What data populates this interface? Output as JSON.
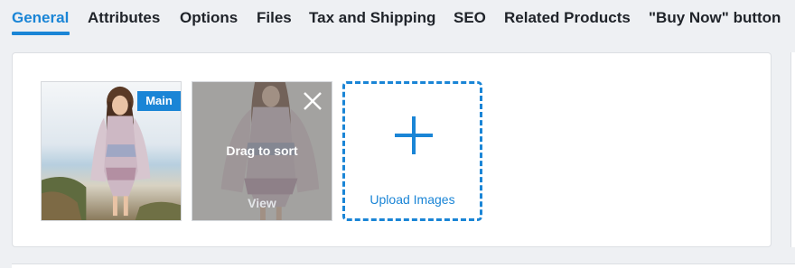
{
  "tabs": [
    {
      "label": "General",
      "active": true
    },
    {
      "label": "Attributes"
    },
    {
      "label": "Options"
    },
    {
      "label": "Files"
    },
    {
      "label": "Tax and Shipping"
    },
    {
      "label": "SEO"
    },
    {
      "label": "Related Products"
    },
    {
      "label": "\"Buy Now\" button"
    }
  ],
  "images": {
    "main_badge": "Main",
    "drag_text": "Drag to sort",
    "view_label": "View",
    "close_icon": "close-icon"
  },
  "upload": {
    "label": "Upload Images",
    "icon": "plus-icon"
  },
  "colors": {
    "accent": "#1a85d6",
    "background": "#eef0f3"
  }
}
